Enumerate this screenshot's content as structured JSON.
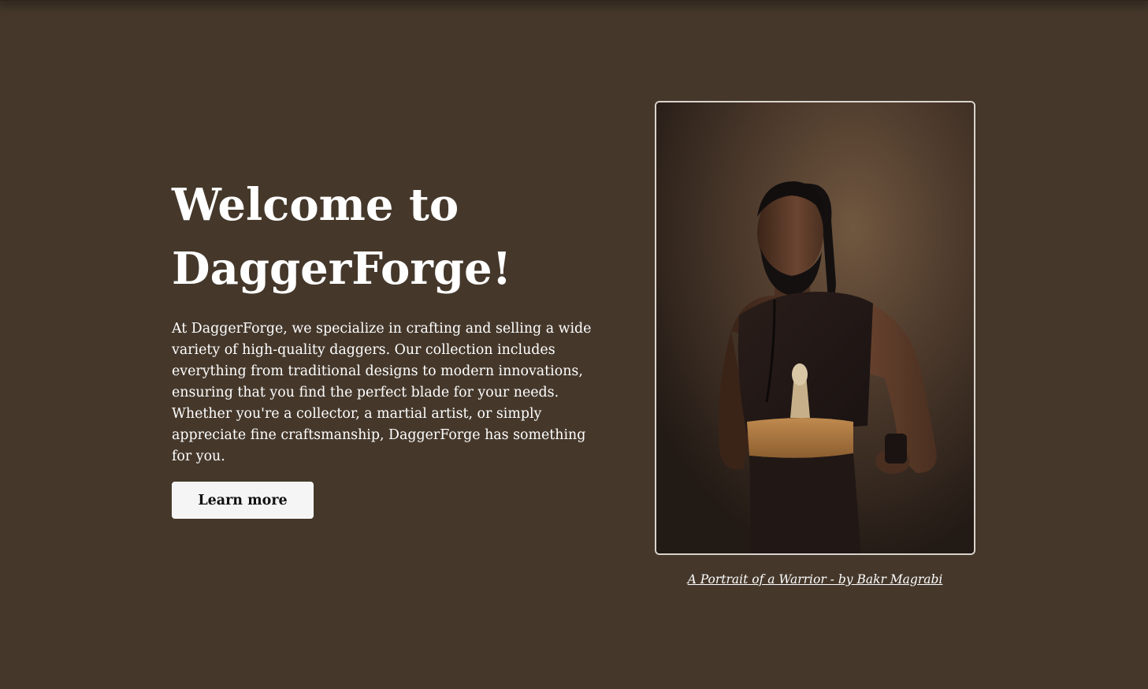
{
  "hero": {
    "title_line1": "Welcome to",
    "title_line2": "DaggerForge!",
    "description": "At DaggerForge, we specialize in crafting and selling a wide variety of high-quality daggers. Our collection includes everything from traditional designs to modern innovations, ensuring that you find the perfect blade for your needs. Whether you're a collector, a martial artist, or simply appreciate fine craftsmanship, DaggerForge has something for you.",
    "cta_label": "Learn more"
  },
  "figure": {
    "caption": "A Portrait of a Warrior - by Bakr Magrabi"
  },
  "colors": {
    "background": "#45382b",
    "button_bg": "#f5f5f5",
    "text": "#ffffff"
  }
}
